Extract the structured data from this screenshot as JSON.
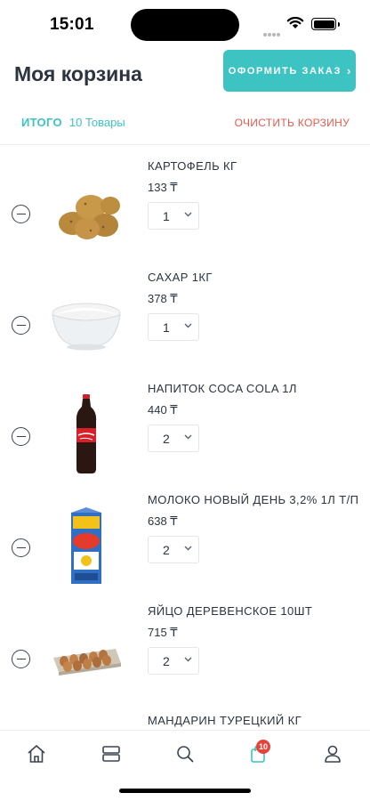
{
  "status_bar": {
    "time": "15:01"
  },
  "header": {
    "title": "Моя корзина",
    "checkout_label": "ОФОРМИТЬ ЗАКАЗ",
    "checkout_chevron": "›"
  },
  "summary": {
    "total_label": "ИТОГО",
    "items_count": "10 Товары",
    "clear_label": "ОЧИСТИТЬ КОРЗИНУ"
  },
  "cart": {
    "items": [
      {
        "name": "КАРТОФЕЛЬ КГ",
        "price": "133 ₸",
        "qty": "1",
        "image": "potatoes"
      },
      {
        "name": "САХАР 1КГ",
        "price": "378 ₸",
        "qty": "1",
        "image": "sugar-bowl"
      },
      {
        "name": "НАПИТОК COCA COLA 1Л",
        "price": "440 ₸",
        "qty": "2",
        "image": "coca-cola-bottle"
      },
      {
        "name": "МОЛОКО НОВЫЙ ДЕНЬ 3,2% 1Л Т/П",
        "price": "638 ₸",
        "qty": "2",
        "image": "milk-carton"
      },
      {
        "name": "ЯЙЦО ДЕРЕВЕНСКОЕ 10ШТ",
        "price": "715 ₸",
        "qty": "2",
        "image": "eggs-tray"
      },
      {
        "name": "МАНДАРИН ТУРЕЦКИЙ КГ"
      }
    ]
  },
  "tab_bar": {
    "items": [
      "home-icon",
      "catalog-icon",
      "search-icon",
      "cart-icon",
      "profile-icon"
    ],
    "cart_badge": "10"
  },
  "colors": {
    "accent": "#3ec3c3",
    "danger": "#e85a4f",
    "badge": "#e8413a",
    "text": "#2b3440"
  }
}
